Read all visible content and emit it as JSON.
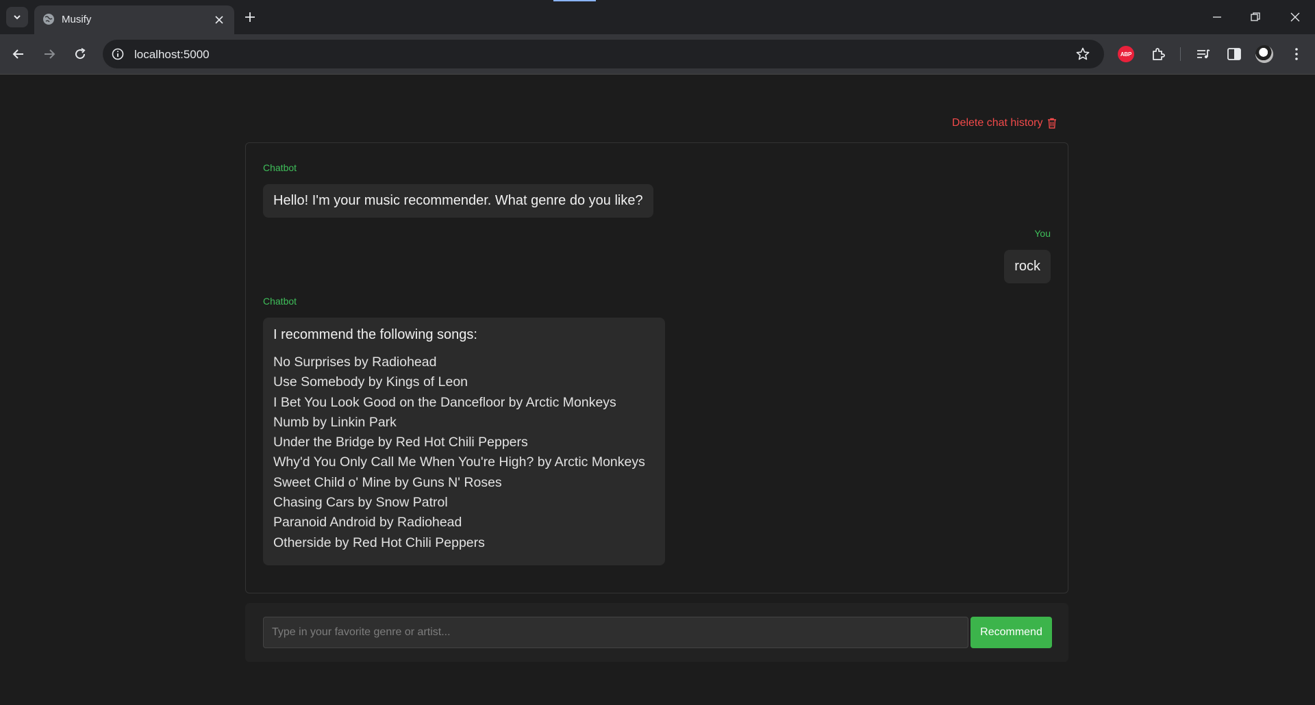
{
  "browser": {
    "tab_title": "Musify",
    "url": "localhost:5000",
    "abp_label": "ABP"
  },
  "page": {
    "delete_label": "Delete chat history",
    "messages": [
      {
        "sender": "Chatbot",
        "text": "Hello! I'm your music recommender. What genre do you like?"
      },
      {
        "sender": "You",
        "text": "rock"
      },
      {
        "sender": "Chatbot",
        "intro": "I recommend the following songs:",
        "songs": [
          "No Surprises by Radiohead",
          "Use Somebody by Kings of Leon",
          "I Bet You Look Good on the Dancefloor by Arctic Monkeys",
          "Numb by Linkin Park",
          "Under the Bridge by Red Hot Chili Peppers",
          "Why'd You Only Call Me When You're High? by Arctic Monkeys",
          "Sweet Child o' Mine by Guns N' Roses",
          "Chasing Cars by Snow Patrol",
          "Paranoid Android by Radiohead",
          "Otherside by Red Hot Chili Peppers"
        ]
      }
    ],
    "input": {
      "placeholder": "Type in your favorite genre or artist...",
      "value": ""
    },
    "recommend_label": "Recommend"
  },
  "colors": {
    "accent_green": "#3cb44b",
    "sender_green": "#3fbf5a",
    "danger_red": "#f24a4a",
    "background": "#1c1c1c",
    "bubble": "#2b2b2b"
  }
}
